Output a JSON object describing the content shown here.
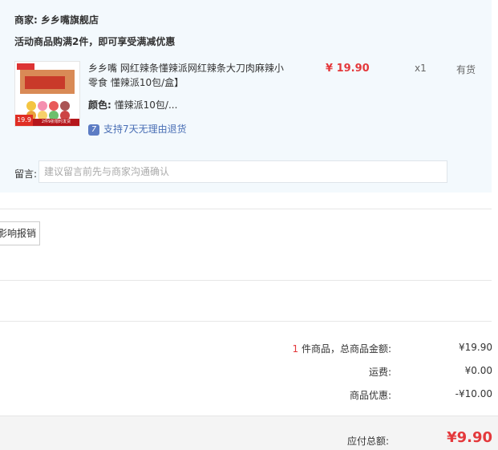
{
  "store": {
    "merchant_label": "商家: 乡乡嘴旗舰店",
    "promo_text": "活动商品购满2件，即可享受满减优惠"
  },
  "product": {
    "title": "乡乡嘴 网红辣条懂辣派网红辣条大刀肉麻辣小零食 懂辣派10包/盒】",
    "color_label": "颜色:",
    "color_value": "懂辣派10包/...",
    "return_icon": "7",
    "return_policy": "支持7天无理由退货",
    "price": "¥ 19.90",
    "quantity": "x1",
    "stock_status": "有货",
    "thumb_price": "19.9",
    "thumb_banner": "2件9折限时发货"
  },
  "message": {
    "label": "留言:",
    "placeholder": "建议留言前先与商家沟通确认"
  },
  "invoice": {
    "button_label": "影响报销"
  },
  "summary": {
    "count": "1",
    "items_total_label": "件商品，总商品金额:",
    "items_total_value": "¥19.90",
    "shipping_label": "运费:",
    "shipping_value": "¥0.00",
    "discount_label": "商品优惠:",
    "discount_value": "-¥10.00",
    "grand_total_label": "应付总额:",
    "grand_total_value": "¥9.90"
  },
  "colors": {
    "panel_bg": "#f3f9fd",
    "accent_red": "#e4393c",
    "link_blue": "#4a6fb5"
  }
}
